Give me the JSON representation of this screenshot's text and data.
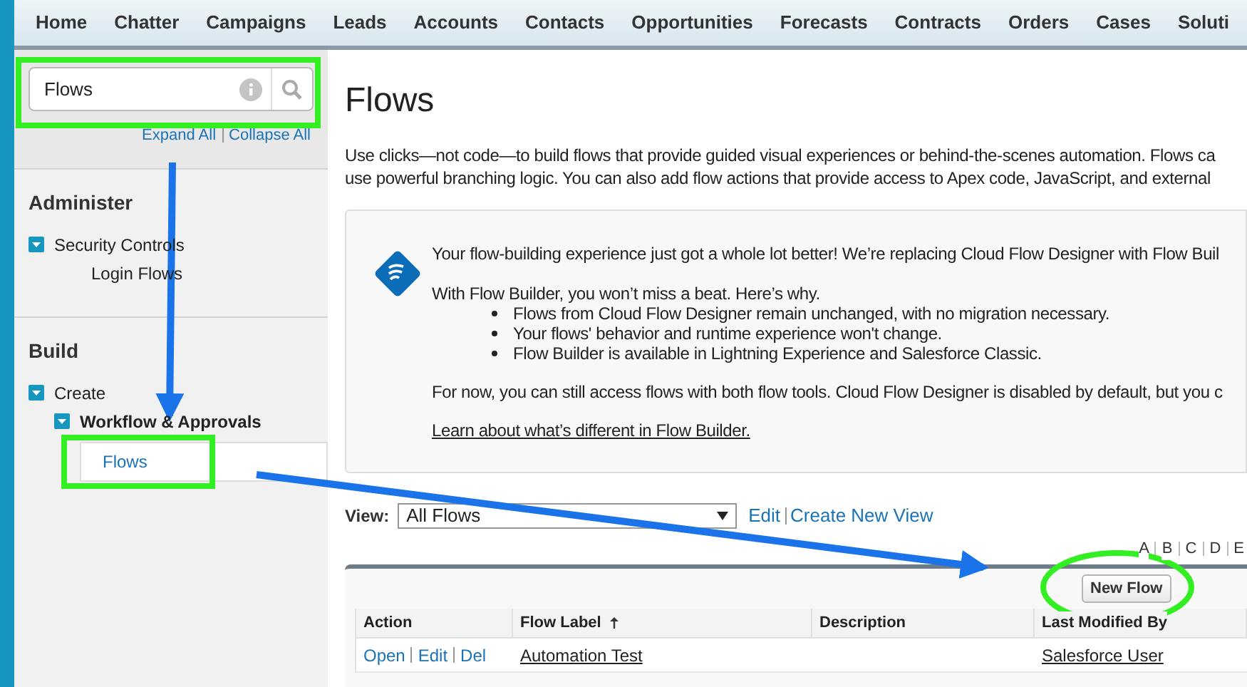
{
  "nav_tabs": [
    "Home",
    "Chatter",
    "Campaigns",
    "Leads",
    "Accounts",
    "Contacts",
    "Opportunities",
    "Forecasts",
    "Contracts",
    "Orders",
    "Cases",
    "Soluti"
  ],
  "sidebar": {
    "search": {
      "value": "Flows"
    },
    "expand_all": "Expand All",
    "collapse_all": "Collapse All",
    "sections": [
      {
        "title": "Administer",
        "items": [
          {
            "label": "Security Controls",
            "expanded": true,
            "children": [
              {
                "label": "Login Flows",
                "selected": false
              }
            ]
          }
        ]
      },
      {
        "title": "Build",
        "items": [
          {
            "label": "Create",
            "expanded": true,
            "children": [
              {
                "label": "Workflow & Approvals",
                "expanded": true,
                "children": [
                  {
                    "label": "Flows",
                    "selected": true
                  }
                ]
              }
            ]
          }
        ]
      }
    ]
  },
  "main": {
    "title": "Flows",
    "intro": [
      "Use clicks—not code—to build flows that provide guided visual experiences or behind-the-scenes automation. Flows ca",
      "use powerful branching logic. You can also add flow actions that provide access to Apex code, JavaScript, and external"
    ],
    "notice": {
      "headline": "Your flow-building experience just got a whole lot better! We’re replacing Cloud Flow Designer with Flow Buil",
      "subhead": "With Flow Builder, you won’t miss a beat. Here’s why.",
      "bullets": [
        "Flows from Cloud Flow Designer remain unchanged, with no migration necessary.",
        "Your flows' behavior and runtime experience won't change.",
        "Flow Builder is available in Lightning Experience and Salesforce Classic."
      ],
      "note": "For now, you can still access flows with both flow tools. Cloud Flow Designer is disabled by default, but you c",
      "link": "Learn about what’s different in Flow Builder."
    },
    "view": {
      "label": "View:",
      "value": "All Flows",
      "edit": "Edit",
      "create": "Create New View"
    },
    "alphabet": [
      "A",
      "B",
      "C",
      "D",
      "E"
    ],
    "table": {
      "button": "New Flow",
      "columns": [
        {
          "label": "Action",
          "sorted": false
        },
        {
          "label": "Flow Label",
          "sorted": true
        },
        {
          "label": "Description",
          "sorted": false
        },
        {
          "label": "Last Modified By",
          "sorted": false
        }
      ],
      "rows": [
        {
          "actions": [
            "Open",
            "Edit",
            "Del"
          ],
          "flow_label": "Automation Test",
          "last_modified_by": "Salesforce User"
        }
      ]
    }
  }
}
